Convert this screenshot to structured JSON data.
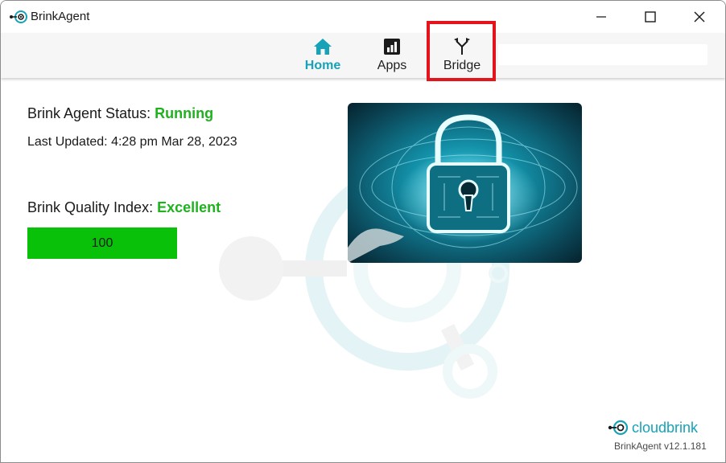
{
  "window": {
    "title": "BrinkAgent",
    "controls": {
      "minimize": "minimize-icon",
      "maximize": "maximize-icon",
      "close": "close-icon"
    }
  },
  "nav": {
    "items": [
      {
        "label": "Home",
        "icon": "home-icon",
        "active": true
      },
      {
        "label": "Apps",
        "icon": "chart-icon",
        "active": false
      },
      {
        "label": "Bridge",
        "icon": "fork-icon",
        "active": false
      }
    ],
    "highlighted": "Bridge",
    "highlight_color": "#e3141b"
  },
  "status": {
    "agent_label": "Brink Agent Status:",
    "agent_value": "Running",
    "updated_label": "Last Updated:",
    "updated_value": "4:28 pm Mar 28, 2023"
  },
  "quality": {
    "label": "Brink Quality Index:",
    "value": "Excellent",
    "score": "100",
    "fill_fraction": 1.0
  },
  "hero_image": {
    "icon": "security-lock-image"
  },
  "footer": {
    "brand": "cloudbrink",
    "version": "BrinkAgent v12.1.181"
  },
  "colors": {
    "accent": "#17a2b8",
    "status_green": "#1fb21f",
    "bar_green": "#0ac10a"
  }
}
